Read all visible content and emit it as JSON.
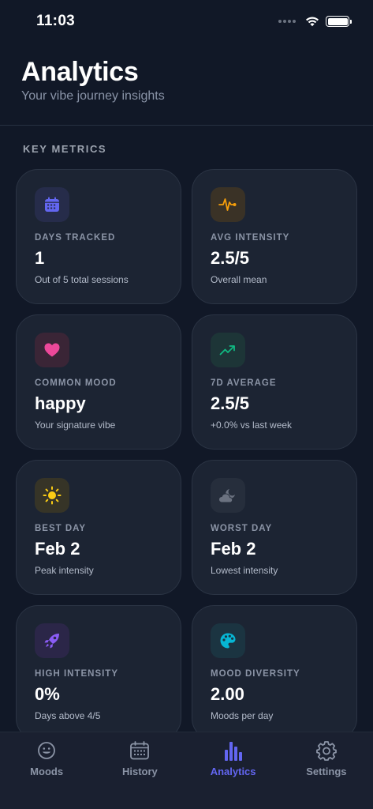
{
  "status_bar": {
    "time": "11:03"
  },
  "header": {
    "title": "Analytics",
    "subtitle": "Your vibe journey insights"
  },
  "section_label": "KEY METRICS",
  "metrics": [
    {
      "label": "DAYS TRACKED",
      "value": "1",
      "caption": "Out of 5 total sessions",
      "icon": "calendar-icon",
      "accent": "#6366f1"
    },
    {
      "label": "AVG INTENSITY",
      "value": "2.5/5",
      "caption": "Overall mean",
      "icon": "pulse-icon",
      "accent": "#f59e0b"
    },
    {
      "label": "COMMON MOOD",
      "value": "happy",
      "caption": "Your signature vibe",
      "icon": "heart-icon",
      "accent": "#ec4899"
    },
    {
      "label": "7D AVERAGE",
      "value": "2.5/5",
      "caption": "+0.0% vs last week",
      "icon": "trending-up-icon",
      "accent": "#10b981"
    },
    {
      "label": "BEST DAY",
      "value": "Feb 2",
      "caption": "Peak intensity",
      "icon": "sun-icon",
      "accent": "#facc15"
    },
    {
      "label": "WORST DAY",
      "value": "Feb 2",
      "caption": "Lowest intensity",
      "icon": "cloud-moon-icon",
      "accent": "#6b7280"
    },
    {
      "label": "HIGH INTENSITY",
      "value": "0%",
      "caption": "Days above 4/5",
      "icon": "rocket-icon",
      "accent": "#8b5cf6"
    },
    {
      "label": "MOOD DIVERSITY",
      "value": "2.00",
      "caption": "Moods per day",
      "icon": "palette-icon",
      "accent": "#06b6d4"
    }
  ],
  "tabs": [
    {
      "label": "Moods",
      "icon": "smiley-icon",
      "active": false
    },
    {
      "label": "History",
      "icon": "calendar-grid-icon",
      "active": false
    },
    {
      "label": "Analytics",
      "icon": "bar-chart-icon",
      "active": true
    },
    {
      "label": "Settings",
      "icon": "gear-icon",
      "active": false
    }
  ],
  "colors": {
    "background": "#111827",
    "card": "#1c2433",
    "accent": "#6366f1",
    "muted": "#8b94a6"
  }
}
